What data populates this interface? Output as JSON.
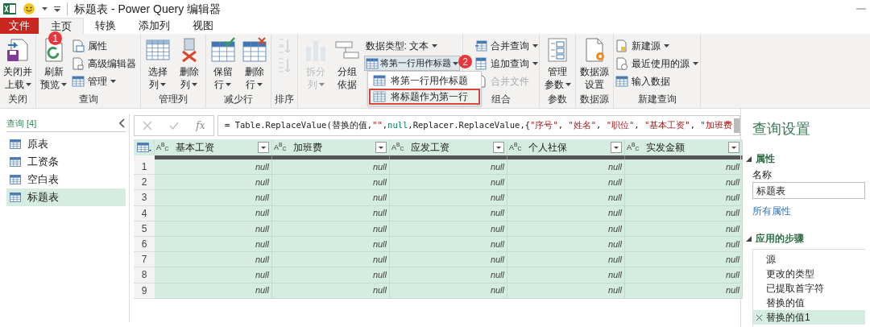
{
  "window": {
    "title": "标题表 - Power Query 编辑器"
  },
  "tabs": [
    {
      "label": "文件",
      "kind": "file",
      "selected": false
    },
    {
      "label": "主页",
      "kind": "tab",
      "selected": true
    },
    {
      "label": "转换",
      "kind": "tab",
      "selected": false
    },
    {
      "label": "添加列",
      "kind": "tab",
      "selected": false
    },
    {
      "label": "视图",
      "kind": "tab",
      "selected": false
    }
  ],
  "ribbon": {
    "groups": [
      {
        "label": "关闭",
        "items": [
          {
            "kind": "large",
            "lines": [
              "关闭并",
              "上载"
            ],
            "dropdown": true,
            "disabled": false
          }
        ]
      },
      {
        "label": "查询",
        "items": [
          {
            "kind": "large",
            "lines": [
              "刷新",
              "预览"
            ],
            "dropdown": true,
            "disabled": false
          },
          {
            "kind": "stack",
            "items": [
              {
                "label": "属性",
                "dropdown": false,
                "disabled": false
              },
              {
                "label": "高级编辑器",
                "dropdown": false,
                "disabled": false
              },
              {
                "label": "管理",
                "dropdown": true,
                "disabled": false
              }
            ]
          }
        ]
      },
      {
        "label": "管理列",
        "items": [
          {
            "kind": "large",
            "lines": [
              "选择",
              "列"
            ],
            "dropdown": true,
            "disabled": false
          },
          {
            "kind": "large",
            "lines": [
              "删除",
              "列"
            ],
            "dropdown": true,
            "disabled": false
          }
        ]
      },
      {
        "label": "减少行",
        "items": [
          {
            "kind": "large",
            "lines": [
              "保留",
              "行"
            ],
            "dropdown": true,
            "disabled": false
          },
          {
            "kind": "large",
            "lines": [
              "删除",
              "行"
            ],
            "dropdown": true,
            "disabled": false
          }
        ]
      },
      {
        "label": "排序",
        "items": [
          {
            "kind": "icons",
            "disabled": true
          }
        ]
      },
      {
        "items": [
          {
            "kind": "large",
            "lines": [
              "拆分",
              "列"
            ],
            "dropdown": true,
            "disabled": true
          },
          {
            "kind": "large",
            "lines": [
              "分组",
              "依据"
            ],
            "dropdown": false,
            "disabled": false
          },
          {
            "kind": "stack",
            "items": [
              {
                "label": "数据类型: 文本",
                "kind": "plain",
                "dropdown": true,
                "disabled": false
              },
              {
                "label": "将第一行用作标题",
                "kind": "split",
                "dropdown": true,
                "disabled": false,
                "expanded": true
              }
            ]
          }
        ]
      },
      {
        "label": "组合",
        "items": [
          {
            "kind": "stack",
            "items": [
              {
                "label": "合并查询",
                "dropdown": true,
                "disabled": false
              },
              {
                "label": "追加查询",
                "dropdown": true,
                "disabled": false
              },
              {
                "label": "合并文件",
                "dropdown": false,
                "disabled": true
              }
            ]
          }
        ]
      },
      {
        "label": "参数",
        "items": [
          {
            "kind": "large",
            "lines": [
              "管理",
              "参数"
            ],
            "dropdown": true,
            "disabled": false
          }
        ]
      },
      {
        "label": "数据源",
        "items": [
          {
            "kind": "large",
            "lines": [
              "数据源",
              "设置"
            ],
            "dropdown": false,
            "disabled": false
          }
        ]
      },
      {
        "label": "新建查询",
        "items": [
          {
            "kind": "stack",
            "items": [
              {
                "label": "新建源",
                "dropdown": true,
                "disabled": false
              },
              {
                "label": "最近使用的源",
                "dropdown": true,
                "disabled": false
              },
              {
                "label": "输入数据",
                "dropdown": false,
                "disabled": false
              }
            ]
          }
        ]
      }
    ]
  },
  "dropdown_menu": [
    {
      "label": "将第一行用作标题",
      "selected": false
    },
    {
      "label": "将标题作为第一行",
      "selected": true
    }
  ],
  "annotations": [
    {
      "text": "1"
    },
    {
      "text": "2"
    }
  ],
  "queries": {
    "header": "查询 [4]",
    "items": [
      {
        "label": "原表",
        "selected": false
      },
      {
        "label": "工资条",
        "selected": false
      },
      {
        "label": "空白表",
        "selected": false
      },
      {
        "label": "标题表",
        "selected": true
      }
    ]
  },
  "formula_bar": {
    "function_label": "fx",
    "segments": [
      {
        "text": "= Table.ReplaceValue(替换的值,",
        "kind": "plain"
      },
      {
        "text": "\"\"",
        "kind": "string"
      },
      {
        "text": ",",
        "kind": "plain"
      },
      {
        "text": "null",
        "kind": "keyword"
      },
      {
        "text": ",Replacer.ReplaceValue,{",
        "kind": "plain"
      },
      {
        "text": "\"序号\"",
        "kind": "string"
      },
      {
        "text": ", ",
        "kind": "plain"
      },
      {
        "text": "\"姓名\"",
        "kind": "string"
      },
      {
        "text": ", ",
        "kind": "plain"
      },
      {
        "text": "\"职位\"",
        "kind": "string"
      },
      {
        "text": ", ",
        "kind": "plain"
      },
      {
        "text": "\"基本工资\"",
        "kind": "string"
      },
      {
        "text": ", ",
        "kind": "plain"
      },
      {
        "text": "\"加班费",
        "kind": "string"
      }
    ]
  },
  "table": {
    "columns": [
      {
        "type": "A$^{B}$$_{C}$",
        "name": "基本工资"
      },
      {
        "type": "A$^{B}$$_{C}$",
        "name": "加班费"
      },
      {
        "type": "A$^{B}$$_{C}$",
        "name": "应发工资"
      },
      {
        "type": "A$^{B}$$_{C}$",
        "name": "个人社保"
      },
      {
        "type": "A$^{B}$$_{C}$",
        "name": "实发金额"
      }
    ],
    "rows": [
      {
        "number": "1",
        "cells": [
          "null",
          "null",
          "null",
          "null",
          "null"
        ]
      },
      {
        "number": "2",
        "cells": [
          "null",
          "null",
          "null",
          "null",
          "null"
        ]
      },
      {
        "number": "3",
        "cells": [
          "null",
          "null",
          "null",
          "null",
          "null"
        ]
      },
      {
        "number": "4",
        "cells": [
          "null",
          "null",
          "null",
          "null",
          "null"
        ]
      },
      {
        "number": "5",
        "cells": [
          "null",
          "null",
          "null",
          "null",
          "null"
        ]
      },
      {
        "number": "6",
        "cells": [
          "null",
          "null",
          "null",
          "null",
          "null"
        ]
      },
      {
        "number": "7",
        "cells": [
          "null",
          "null",
          "null",
          "null",
          "null"
        ]
      },
      {
        "number": "8",
        "cells": [
          "null",
          "null",
          "null",
          "null",
          "null"
        ]
      },
      {
        "number": "9",
        "cells": [
          "null",
          "null",
          "null",
          "null",
          "null"
        ]
      }
    ]
  },
  "query_settings": {
    "title": "查询设置",
    "properties_header": "属性",
    "name_label": "名称",
    "name_value": "标题表",
    "all_properties_link": "所有属性",
    "steps_header": "应用的步骤",
    "steps": [
      {
        "label": "源",
        "selected": false
      },
      {
        "label": "更改的类型",
        "selected": false
      },
      {
        "label": "已提取首字符",
        "selected": false
      },
      {
        "label": "替换的值",
        "selected": false
      },
      {
        "label": "替换的值1",
        "selected": true
      }
    ]
  }
}
